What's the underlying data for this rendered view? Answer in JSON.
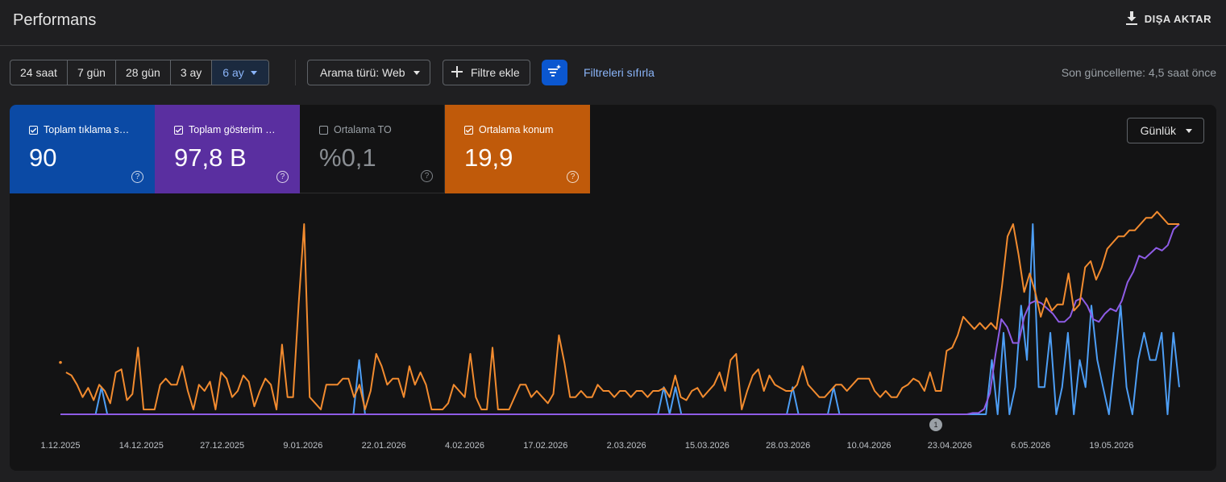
{
  "header": {
    "title": "Performans",
    "export_label": "DIŞA AKTAR",
    "export_icon": "download-icon"
  },
  "toolbar": {
    "date_ranges": [
      "24 saat",
      "7 gün",
      "28 gün",
      "3 ay",
      "6 ay"
    ],
    "active_range": "6 ay",
    "search_type": "Arama türü: Web",
    "add_filter": "Filtre ekle",
    "reset_filters": "Filtreleri sıfırla",
    "last_update": "Son güncelleme: 4,5 saat önce"
  },
  "metrics": [
    {
      "label": "Toplam tıklama s…",
      "value": "90",
      "checked": true,
      "color": "#4d9ef5"
    },
    {
      "label": "Toplam gösterim …",
      "value": "97,8 B",
      "checked": true,
      "color": "#8e5ce6"
    },
    {
      "label": "Ortalama TO",
      "value": "%0,1",
      "checked": false,
      "color": "#1fa38a"
    },
    {
      "label": "Ortalama konum",
      "value": "19,9",
      "checked": true,
      "color": "#f28b2f"
    }
  ],
  "period_selector": "Günlük",
  "chart_data": {
    "type": "line",
    "x_tick_labels": [
      "1.12.2025",
      "14.12.2025",
      "27.12.2025",
      "9.01.2026",
      "22.01.2026",
      "4.02.2026",
      "17.02.2026",
      "2.03.2026",
      "15.03.2026",
      "28.03.2026",
      "10.04.2026",
      "23.04.2026",
      "6.05.2026",
      "19.05.2026"
    ],
    "annotation": "1",
    "series": [
      {
        "name": "Toplam tıklama sayısı",
        "color": "#4d9ef5",
        "values": [
          0,
          0,
          0,
          0,
          0,
          0,
          0,
          3,
          0,
          0,
          0,
          0,
          0,
          0,
          0,
          0,
          0,
          0,
          0,
          0,
          0,
          0,
          0,
          0,
          0,
          0,
          0,
          0,
          0,
          0,
          0,
          0,
          0,
          0,
          0,
          0,
          0,
          0,
          0,
          0,
          0,
          0,
          0,
          0,
          0,
          0,
          0,
          0,
          0,
          0,
          0,
          6,
          0,
          0,
          0,
          0,
          0,
          0,
          0,
          0,
          0,
          0,
          0,
          0,
          0,
          0,
          0,
          0,
          0,
          0,
          0,
          0,
          0,
          0,
          0,
          0,
          0,
          0,
          0,
          0,
          0,
          0,
          0,
          0,
          0,
          0,
          0,
          0,
          0,
          0,
          0,
          0,
          0,
          0,
          0,
          0,
          0,
          0,
          0,
          0,
          0,
          0,
          0,
          3,
          0,
          3,
          0,
          0,
          0,
          0,
          0,
          0,
          0,
          0,
          0,
          0,
          0,
          0,
          0,
          0,
          0,
          0,
          0,
          0,
          0,
          3,
          0,
          0,
          0,
          0,
          0,
          0,
          3,
          0,
          0,
          0,
          0,
          0,
          0,
          0,
          0,
          0,
          0,
          0,
          0,
          0,
          0,
          0,
          0,
          0,
          0,
          0,
          0,
          0,
          0,
          0,
          0,
          0,
          0,
          6,
          0,
          9,
          0,
          3,
          12,
          6,
          21,
          3,
          3,
          9,
          0,
          3,
          9,
          0,
          6,
          3,
          12,
          6,
          3,
          0,
          6,
          12,
          3,
          0,
          6,
          9,
          6,
          6,
          9,
          0,
          9,
          3
        ]
      },
      {
        "name": "Toplam gösterim sayısı",
        "color": "#8e5ce6",
        "values": [
          0,
          0,
          0,
          0,
          0,
          0,
          0,
          0,
          0,
          0,
          0,
          0,
          0,
          0,
          0,
          0,
          0,
          0,
          0,
          0,
          0,
          0,
          0,
          0,
          0,
          0,
          0,
          0,
          0,
          0,
          0,
          0,
          0,
          0,
          0,
          0,
          0,
          0,
          0,
          0,
          0,
          0,
          0,
          0,
          0,
          0,
          0,
          0,
          0,
          0,
          0,
          0,
          0,
          0,
          0,
          0,
          0,
          0,
          0,
          0,
          0,
          0,
          0,
          0,
          0,
          0,
          0,
          0,
          0,
          0,
          0,
          0,
          0,
          0,
          0,
          0,
          0,
          0,
          0,
          0,
          0,
          0,
          0,
          0,
          0,
          0,
          0,
          0,
          0,
          0,
          0,
          0,
          0,
          0,
          0,
          0,
          0,
          0,
          0,
          0,
          0,
          0,
          0,
          0,
          0,
          0,
          0,
          0,
          0,
          0,
          0,
          0,
          0,
          0,
          0,
          0,
          0,
          0,
          0,
          0,
          0,
          0,
          0,
          0,
          0,
          0,
          0,
          0,
          0,
          0,
          0,
          0,
          0,
          0,
          0,
          0,
          0,
          0,
          0,
          0,
          0,
          0,
          0,
          0,
          0,
          0,
          0,
          0,
          0,
          0,
          0,
          0,
          0,
          0,
          0,
          0,
          0,
          0,
          0,
          0.5,
          0.5,
          2,
          8,
          23,
          36,
          33,
          27,
          27,
          37,
          42,
          43,
          42,
          40,
          38,
          35,
          35,
          37,
          43,
          44,
          41,
          36,
          35,
          38,
          40,
          39,
          43,
          50,
          54,
          60,
          59,
          61,
          63,
          62,
          64,
          70,
          72
        ]
      },
      {
        "name": "Ortalama konum",
        "color": "#f28b2f",
        "values": [
          5,
          6,
          5.5,
          4,
          2,
          3.5,
          1.5,
          4,
          3,
          1,
          6,
          6.5,
          1.5,
          2.5,
          10,
          0,
          0,
          0,
          4,
          5,
          4,
          4,
          7,
          3,
          0,
          4,
          3,
          4.5,
          0,
          6,
          5,
          2,
          3,
          5.5,
          4.5,
          0.5,
          3,
          5,
          4,
          0,
          10.5,
          2,
          2,
          17,
          30,
          2,
          1,
          0,
          4,
          4,
          4,
          5,
          5,
          2,
          4,
          0,
          3,
          9,
          7,
          4,
          5,
          5,
          2,
          7,
          4,
          6,
          4,
          0,
          0,
          0,
          1,
          4,
          3,
          2,
          9,
          2,
          0,
          0,
          10,
          0,
          0,
          0,
          2,
          4,
          4,
          2,
          3,
          2,
          1,
          2.5,
          12,
          7.5,
          2,
          2,
          3,
          2,
          2,
          4,
          3,
          3,
          2,
          3,
          3,
          2,
          3,
          3,
          2,
          3,
          3,
          3.5,
          2,
          5.5,
          2,
          1.5,
          3,
          3.5,
          2,
          3,
          4,
          6,
          3,
          8,
          9,
          0,
          3,
          5.5,
          6.5,
          3,
          5.5,
          4,
          3.5,
          3,
          3,
          4,
          7,
          4,
          3,
          2,
          2,
          3,
          4,
          4,
          3,
          4,
          5,
          5,
          5,
          3,
          2,
          3,
          2,
          2,
          3.5,
          4,
          5,
          4.5,
          3,
          6,
          3,
          3,
          9.5,
          10,
          12,
          15,
          14,
          13,
          14,
          13,
          14,
          13,
          20,
          28,
          30,
          25,
          19,
          22,
          19,
          15,
          18,
          16,
          17,
          17,
          22,
          16,
          17,
          23,
          24,
          21,
          23,
          26,
          27,
          28,
          28,
          29,
          29,
          30,
          31,
          31,
          32,
          31,
          30,
          30,
          30
        ]
      }
    ],
    "legend": "metric cards above chart",
    "grid": false
  }
}
